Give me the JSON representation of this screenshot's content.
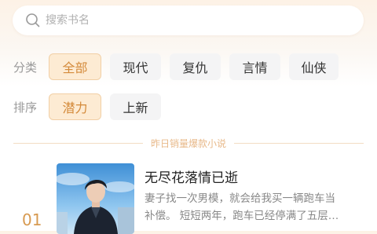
{
  "search": {
    "placeholder": "搜索书名",
    "icon": "search-icon"
  },
  "category": {
    "label": "分类",
    "options": [
      "全部",
      "现代",
      "复仇",
      "言情",
      "仙侠"
    ],
    "selected": "全部"
  },
  "sort": {
    "label": "排序",
    "options": [
      "潜力",
      "上新"
    ],
    "selected": "潜力"
  },
  "section_title": "昨日销量爆款小说",
  "books": [
    {
      "rank": "01",
      "title": "无尽花落情已逝",
      "desc_line1": "妻子找一次男模，就会给我买一辆跑车当",
      "desc_line2": "补偿。 短短两年，跑车已经停满了五层…"
    }
  ],
  "colors": {
    "accent": "#d48a3a",
    "accent_bg": "#fdebd3",
    "chip_bg": "#f4f4f5",
    "rank": "#d79a51"
  }
}
